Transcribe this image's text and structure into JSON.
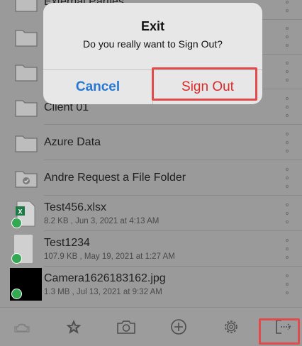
{
  "files": [
    {
      "type": "folder",
      "name": "External Parties",
      "meta": ""
    },
    {
      "type": "folder",
      "name": "",
      "meta": ""
    },
    {
      "type": "folder",
      "name": "",
      "meta": ""
    },
    {
      "type": "folder",
      "name": "Client 01",
      "meta": ""
    },
    {
      "type": "folder",
      "name": "Azure Data",
      "meta": ""
    },
    {
      "type": "request-folder",
      "name": "Andre Request a File Folder",
      "meta": ""
    },
    {
      "type": "xlsx",
      "name": "Test456.xlsx",
      "meta": "8.2 KB , Jun 3, 2021 at 4:13 AM"
    },
    {
      "type": "doc",
      "name": "Test1234",
      "meta": "107.9 KB , May 19, 2021 at 1:27 AM"
    },
    {
      "type": "image",
      "name": "Camera1626183162.jpg",
      "meta": "1.3 MB , Jul 13, 2021 at 9:32 AM"
    }
  ],
  "dialog": {
    "title": "Exit",
    "message": "Do you really want to Sign Out?",
    "cancel_label": "Cancel",
    "confirm_label": "Sign Out"
  },
  "toolbar": {
    "items": [
      "cloud-icon",
      "star-icon",
      "camera-icon",
      "add-icon",
      "settings-icon",
      "sign-out-icon"
    ]
  },
  "colors": {
    "cancel": "#2778d3",
    "sign_out": "#d72a2a",
    "highlight": "#e24b4b",
    "synced_check": "#34a853"
  }
}
